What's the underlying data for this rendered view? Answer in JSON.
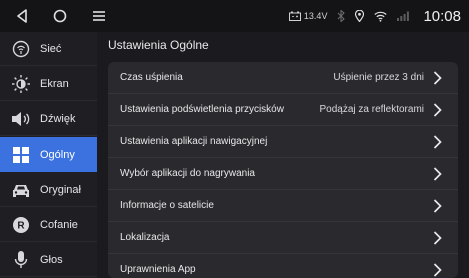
{
  "status_bar": {
    "voltage": "13.4V",
    "time": "10:08"
  },
  "sidebar": {
    "items": [
      {
        "label": "Sieć",
        "active": false
      },
      {
        "label": "Ekran",
        "active": false
      },
      {
        "label": "Dźwięk",
        "active": false
      },
      {
        "label": "Ogólny",
        "active": true
      },
      {
        "label": "Oryginał",
        "active": false
      },
      {
        "label": "Cofanie",
        "active": false
      },
      {
        "label": "Głos",
        "active": false
      }
    ]
  },
  "main": {
    "title": "Ustawienia Ogólne",
    "rows": [
      {
        "label": "Czas uśpienia",
        "value": "Uśpienie przez 3 dni"
      },
      {
        "label": "Ustawienia podświetlenia przycisków",
        "value": "Podążaj za reflektorami"
      },
      {
        "label": "Ustawienia aplikacji nawigacyjnej",
        "value": ""
      },
      {
        "label": "Wybór aplikacji do nagrywania",
        "value": ""
      },
      {
        "label": "Informacje o satelicie",
        "value": ""
      },
      {
        "label": "Lokalizacja",
        "value": ""
      },
      {
        "label": "Uprawnienia App",
        "value": ""
      }
    ]
  },
  "colors": {
    "accent": "#3b72e0",
    "background": "#1b1b1f",
    "panel": "#2a2a2e"
  }
}
